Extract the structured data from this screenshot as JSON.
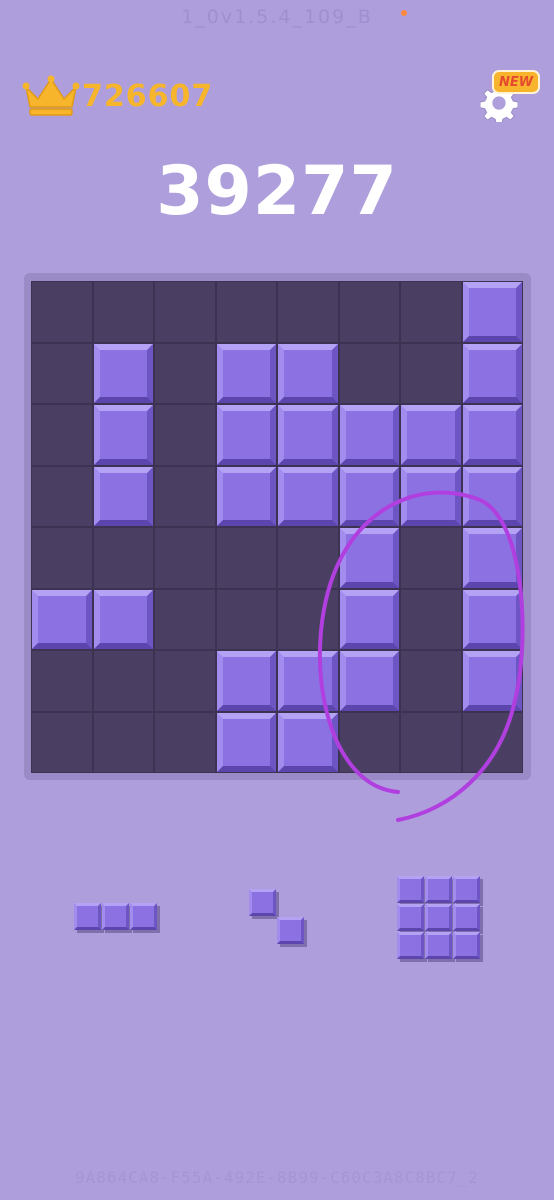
{
  "version": "1_0v1.5.4_109_B",
  "best_score": "726607",
  "current_score": "39277",
  "settings_badge": "NEW",
  "icons": {
    "best": "crown-icon",
    "settings": "gear-icon"
  },
  "board": {
    "size": 8,
    "rows": [
      "00000001",
      "01011001",
      "01011111",
      "01011111",
      "00000101",
      "11000101",
      "00011101",
      "00011000"
    ]
  },
  "pieces": [
    {
      "name": "piece-horizontal-3",
      "shape": [
        "111"
      ]
    },
    {
      "name": "piece-diagonal-2",
      "shape": [
        "10",
        "01"
      ]
    },
    {
      "name": "piece-square-3x3",
      "shape": [
        "111",
        "111",
        "111"
      ]
    }
  ],
  "device_id": "9A864CA8-F55A-492E-8B99-C60C3A8C8BC7_2",
  "colors": {
    "background": "#ae9fdc",
    "board": "#4a3f62",
    "block": "#8c71e2",
    "best_score": "#f6b52a",
    "annotation": "#b13fe0"
  }
}
